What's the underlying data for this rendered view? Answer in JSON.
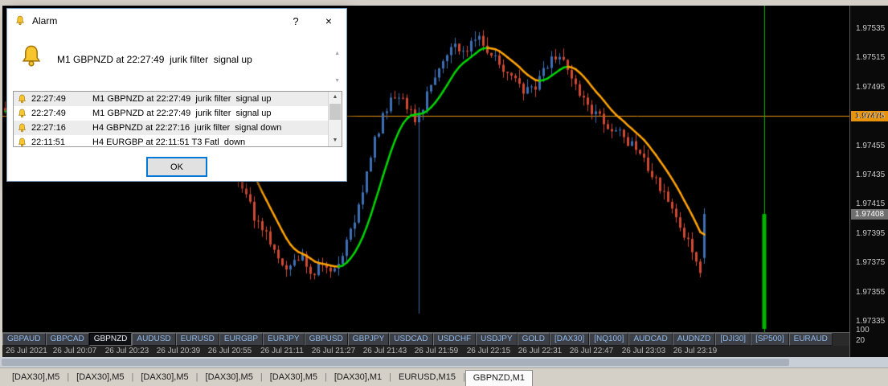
{
  "window": {
    "price_axis": {
      "ticks": [
        "1.97535",
        "1.97515",
        "1.97495",
        "1.97475",
        "1.97455",
        "1.97435",
        "1.97415",
        "1.97395",
        "1.97375",
        "1.97355",
        "1.97335"
      ],
      "alert_price": "1.97475",
      "current_price": "1.97408",
      "volume_ticks": [
        "100",
        "20"
      ]
    },
    "time_axis": {
      "labels": [
        "26 Jul 2021",
        "26 Jul 20:07",
        "26 Jul 20:23",
        "26 Jul 20:39",
        "26 Jul 20:55",
        "26 Jul 21:11",
        "26 Jul 21:27",
        "26 Jul 21:43",
        "26 Jul 21:59",
        "26 Jul 22:15",
        "26 Jul 22:31",
        "26 Jul 22:47",
        "26 Jul 23:03",
        "26 Jul 23:19"
      ]
    },
    "symbol_bar": {
      "symbols": [
        "GBPAUD",
        "GBPCAD",
        "GBPNZD",
        "AUDUSD",
        "EURUSD",
        "EURGBP",
        "EURJPY",
        "GBPUSD",
        "GBPJPY",
        "USDCAD",
        "USDCHF",
        "USDJPY",
        "GOLD",
        "[DAX30]",
        "[NQ100]",
        "AUDCAD",
        "AUDNZD",
        "[DJI30]",
        "[SP500]",
        "EURAUD"
      ],
      "active": "GBPNZD"
    },
    "chart_tabs": {
      "tabs": [
        "[DAX30],M5",
        "[DAX30],M5",
        "[DAX30],M5",
        "[DAX30],M5",
        "[DAX30],M5",
        "[DAX30],M1",
        "EURUSD,M15",
        "GBPNZD,M1"
      ],
      "active_index": 7
    }
  },
  "alarm_dialog": {
    "title": "Alarm",
    "help_label": "?",
    "close_label": "×",
    "message": "M1 GBPNZD at 22:27:49  jurik filter  signal up",
    "ok_label": "OK",
    "entries": [
      {
        "time": "22:27:49",
        "text": "M1 GBPNZD at 22:27:49  jurik filter  signal up"
      },
      {
        "time": "22:27:49",
        "text": "M1 GBPNZD at 22:27:49  jurik filter  signal up"
      },
      {
        "time": "22:27:16",
        "text": "H4 GBPNZD at 22:27:16  jurik filter  signal down"
      },
      {
        "time": "22:11:51",
        "text": "H4 EURGBP at 22:11:51 T3 Fatl  down"
      }
    ]
  },
  "chart_data": {
    "type": "candlestick",
    "title": "GBPNZD,M1",
    "price_top": 1.975504,
    "price_bottom": 1.973273,
    "bar_count": 175,
    "bar_spacing": 5,
    "last_price": 1.97408,
    "alert_price": 1.97475,
    "spike": {
      "x_frac": 0.492,
      "low": 1.9734
    },
    "separator_x_frac": 0.899,
    "ma": {
      "period": 6,
      "period2": 5
    },
    "price_path": [
      [
        0.0,
        1.9748
      ],
      [
        0.06,
        1.97494
      ],
      [
        0.11,
        1.97502
      ],
      [
        0.16,
        1.97492
      ],
      [
        0.21,
        1.97486
      ],
      [
        0.245,
        1.97468
      ],
      [
        0.265,
        1.97452
      ],
      [
        0.28,
        1.97428
      ],
      [
        0.298,
        1.97404
      ],
      [
        0.318,
        1.97386
      ],
      [
        0.335,
        1.97371
      ],
      [
        0.35,
        1.9738
      ],
      [
        0.364,
        1.97368
      ],
      [
        0.377,
        1.97375
      ],
      [
        0.389,
        1.97366
      ],
      [
        0.401,
        1.97381
      ],
      [
        0.413,
        1.974
      ],
      [
        0.425,
        1.97425
      ],
      [
        0.437,
        1.97455
      ],
      [
        0.45,
        1.97478
      ],
      [
        0.462,
        1.9749
      ],
      [
        0.475,
        1.97482
      ],
      [
        0.488,
        1.9747
      ],
      [
        0.5,
        1.9749
      ],
      [
        0.515,
        1.97512
      ],
      [
        0.53,
        1.97524
      ],
      [
        0.545,
        1.97518
      ],
      [
        0.56,
        1.9753
      ],
      [
        0.578,
        1.97516
      ],
      [
        0.597,
        1.97504
      ],
      [
        0.614,
        1.9749
      ],
      [
        0.63,
        1.97497
      ],
      [
        0.645,
        1.97512
      ],
      [
        0.658,
        1.97516
      ],
      [
        0.672,
        1.975
      ],
      [
        0.69,
        1.97482
      ],
      [
        0.71,
        1.9747
      ],
      [
        0.73,
        1.97463
      ],
      [
        0.748,
        1.9745
      ],
      [
        0.768,
        1.97434
      ],
      [
        0.788,
        1.97414
      ],
      [
        0.803,
        1.97396
      ],
      [
        0.8145,
        1.97378
      ],
      [
        0.822,
        1.97366
      ],
      [
        0.8275,
        1.9739
      ],
      [
        0.83,
        1.97408
      ]
    ],
    "colors": {
      "up": "#3f6fb5",
      "down": "#cf4a33",
      "ma_up": "#00d400",
      "ma_down": "#ffa200",
      "alert_line": "#e8930c",
      "separator": "#00b400",
      "background": "#000000"
    }
  }
}
